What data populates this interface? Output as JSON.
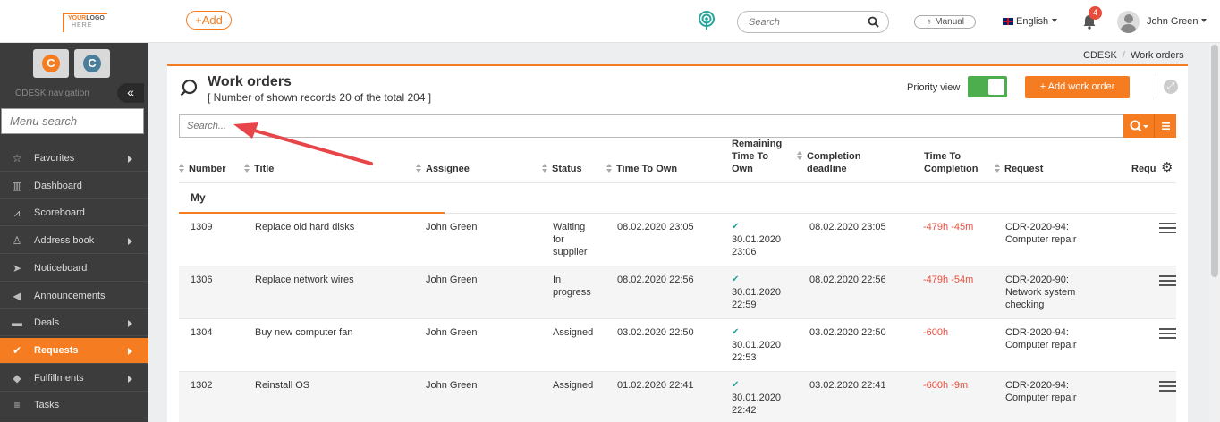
{
  "topbar": {
    "logo_line1_a": "YOUR",
    "logo_line1_b": "LOGO",
    "logo_line2": "HERE",
    "add_label": "+Add",
    "search_placeholder": "Search",
    "manual_label": "Manual",
    "language": "English",
    "notifications_count": "4",
    "user_name": "John Green"
  },
  "sidebar": {
    "nav_label": "CDESK navigation",
    "collapse_label": "«",
    "search_placeholder": "Menu search",
    "items": [
      {
        "label": "Favorites",
        "icon": "star-icon",
        "glyph": "☆",
        "arrow": true,
        "active": false
      },
      {
        "label": "Dashboard",
        "icon": "dashboard-icon",
        "glyph": "▥",
        "arrow": false,
        "active": false
      },
      {
        "label": "Scoreboard",
        "icon": "chart-icon",
        "glyph": "⩘",
        "arrow": false,
        "active": false
      },
      {
        "label": "Address book",
        "icon": "user-icon",
        "glyph": "♙",
        "arrow": true,
        "active": false
      },
      {
        "label": "Noticeboard",
        "icon": "paper-plane-icon",
        "glyph": "➤",
        "arrow": false,
        "active": false
      },
      {
        "label": "Announcements",
        "icon": "megaphone-icon",
        "glyph": "◀",
        "arrow": false,
        "active": false
      },
      {
        "label": "Deals",
        "icon": "wallet-icon",
        "glyph": "▬",
        "arrow": true,
        "active": false
      },
      {
        "label": "Requests",
        "icon": "check-circle-icon",
        "glyph": "✔",
        "arrow": true,
        "active": true
      },
      {
        "label": "Fulfillments",
        "icon": "cube-icon",
        "glyph": "◆",
        "arrow": true,
        "active": false
      },
      {
        "label": "Tasks",
        "icon": "tasks-icon",
        "glyph": "≡",
        "arrow": false,
        "active": false
      }
    ]
  },
  "breadcrumb": {
    "root": "CDESK",
    "separator": "/",
    "current": "Work orders"
  },
  "panel": {
    "title": "Work orders",
    "subtitle": "[ Number of shown records 20 of the total 204 ]",
    "priority_label": "Priority view",
    "add_button": "+ Add work order",
    "search_placeholder": "Search..."
  },
  "table": {
    "headers": {
      "number": "Number",
      "title": "Title",
      "assignee": "Assignee",
      "status": "Status",
      "time_to_own": "Time To Own",
      "remaining_1": "Remaining",
      "remaining_2": "Time To",
      "remaining_3": "Own",
      "deadline_1": "Completion",
      "deadline_2": "deadline",
      "ttc_1": "Time To",
      "ttc_2": "Completion",
      "request": "Request",
      "requ": "Requ"
    },
    "group": "My",
    "rows": [
      {
        "number": "1309",
        "title": "Replace old hard disks",
        "assignee": "John Green",
        "status": [
          "Waiting",
          "for",
          "supplier"
        ],
        "time_to_own": "08.02.2020 23:05",
        "remaining": [
          "30.01.2020",
          "23:06"
        ],
        "deadline": "08.02.2020 23:05",
        "ttc": "-479h -45m",
        "request": [
          "CDR-2020-94:",
          "Computer repair"
        ]
      },
      {
        "number": "1306",
        "title": "Replace network wires",
        "assignee": "John Green",
        "status": [
          "In",
          "progress"
        ],
        "time_to_own": "08.02.2020 22:56",
        "remaining": [
          "30.01.2020",
          "22:59"
        ],
        "deadline": "08.02.2020 22:56",
        "ttc": "-479h -54m",
        "request": [
          "CDR-2020-90:",
          "Network system",
          "checking"
        ]
      },
      {
        "number": "1304",
        "title": "Buy new computer fan",
        "assignee": "John Green",
        "status": [
          "Assigned"
        ],
        "time_to_own": "03.02.2020 22:50",
        "remaining": [
          "30.01.2020",
          "22:53"
        ],
        "deadline": "03.02.2020 22:50",
        "ttc": "-600h",
        "request": [
          "CDR-2020-94:",
          "Computer repair"
        ]
      },
      {
        "number": "1302",
        "title": "Reinstall OS",
        "assignee": "John Green",
        "status": [
          "Assigned"
        ],
        "time_to_own": "01.02.2020 22:41",
        "remaining": [
          "30.01.2020",
          "22:42"
        ],
        "deadline": "03.02.2020 22:41",
        "ttc": "-600h -9m",
        "request": [
          "CDR-2020-94:",
          "Computer repair"
        ]
      }
    ]
  },
  "colors": {
    "accent": "#f57c20",
    "sidebar_bg": "#3c3c3c",
    "negative": "#e74c3c",
    "check": "#2aa198",
    "toggle_on": "#4cae4c"
  }
}
